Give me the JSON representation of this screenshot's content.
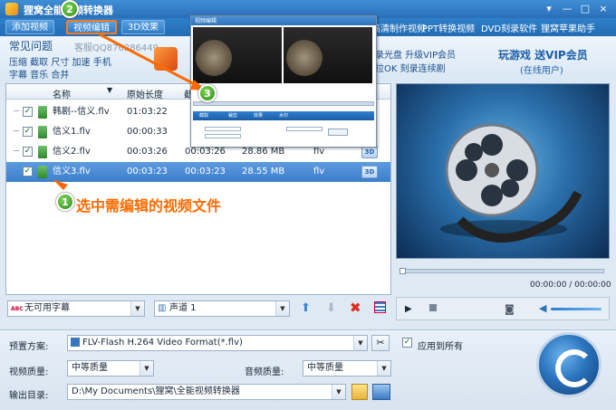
{
  "window": {
    "title": "狸窝全能视频转换器",
    "controls": [
      "▾",
      "—",
      "□",
      "×"
    ]
  },
  "toolbar": {
    "add_video": "添加视频",
    "edit_video": "视频编辑",
    "effect_3d": "3D效果"
  },
  "top_links": [
    "高清制作视频",
    "PPT转换视频",
    "DVD刻录软件",
    "狸窝苹果助手"
  ],
  "promo": {
    "faq_title": "常见问题",
    "support": "客服QQ876286449",
    "faq_line1": "压缩 截取 尺寸 加速 手机",
    "faq_line2": "字幕 音乐 合并",
    "mid_line1": "录光盘 升级VIP会员",
    "mid_line2": "拉OK 刻录连续剧",
    "vip_title": "玩游戏 送VIP会员",
    "vip_sub": "(在线用户)"
  },
  "table": {
    "headers": [
      "名称",
      "原始长度",
      "截"
    ],
    "rows": [
      {
        "name": "韩剧--信义.flv",
        "orig_len": "01:03:22",
        "cut_len": "",
        "size": "",
        "format": "",
        "checked": true
      },
      {
        "name": "信义1.flv",
        "orig_len": "00:00:33",
        "cut_len": "",
        "size": "",
        "format": "",
        "checked": true
      },
      {
        "name": "信义2.flv",
        "orig_len": "00:03:26",
        "cut_len": "00:03:26",
        "size": "28.86 MB",
        "format": "flv",
        "checked": true
      },
      {
        "name": "信义3.flv",
        "orig_len": "00:03:23",
        "cut_len": "00:03:23",
        "size": "28.55 MB",
        "format": "flv",
        "checked": true
      }
    ]
  },
  "badge_3d": "3D",
  "player": {
    "time": "00:00:00 / 00:00:00"
  },
  "subtitle": {
    "value": "无可用字幕",
    "icon_text": "ABC"
  },
  "audio": {
    "value": "声道 1"
  },
  "settings": {
    "preset_label": "预置方案:",
    "preset_value": "FLV-Flash H.264 Video Format(*.flv)",
    "apply_all": "应用到所有",
    "video_quality_label": "视频质量:",
    "video_quality_value": "中等质量",
    "audio_quality_label": "音频质量:",
    "audio_quality_value": "中等质量",
    "output_label": "输出目录:",
    "output_value": "D:\\My Documents\\狸窝\\全能视频转换器"
  },
  "annotations": {
    "m1": "1",
    "m2": "2",
    "m3": "3",
    "hint": "选中需编辑的视频文件"
  },
  "overlay": {
    "title": "视频编辑",
    "tabs": [
      "截取",
      "裁剪",
      "效果",
      "水印"
    ]
  }
}
